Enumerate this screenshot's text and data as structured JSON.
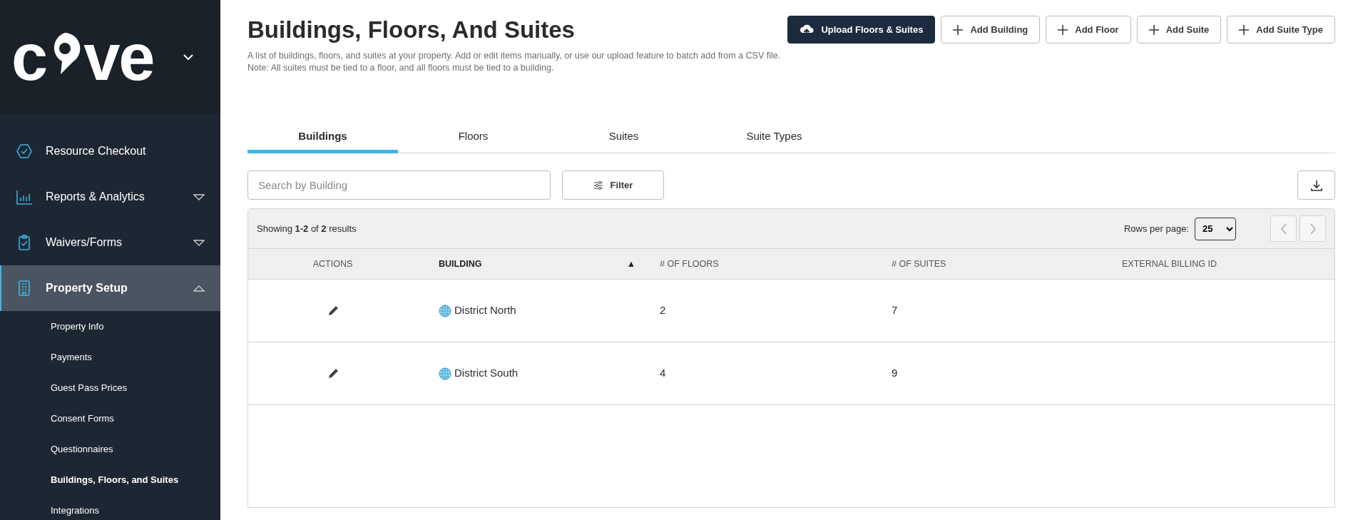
{
  "sidebar": {
    "logo": {
      "start": "c",
      "end": "ve"
    },
    "items": [
      {
        "label": "Resource Checkout",
        "selected": false
      },
      {
        "label": "Reports & Analytics",
        "expanded": false,
        "selected": false
      },
      {
        "label": "Waivers/Forms",
        "expanded": false,
        "selected": false
      },
      {
        "label": "Property Setup",
        "expanded": true,
        "selected": true,
        "children": [
          {
            "label": "Property Info",
            "selected": false
          },
          {
            "label": "Payments",
            "selected": false
          },
          {
            "label": "Guest Pass Prices",
            "selected": false
          },
          {
            "label": "Consent Forms",
            "selected": false
          },
          {
            "label": "Questionnaires",
            "selected": false
          },
          {
            "label": "Buildings, Floors, and Suites",
            "selected": true
          },
          {
            "label": "Integrations",
            "selected": false
          }
        ]
      }
    ]
  },
  "page": {
    "title": "Buildings, Floors, And Suites",
    "description": [
      "A list of buildings, floors, and suites at your property. Add or edit items manually, or use our upload feature to batch add from a CSV file.",
      "Note: All suites must be tied to a floor, and all floors must be tied to a building."
    ],
    "actions": [
      {
        "label": "Upload Floors & Suites",
        "kind": "upload"
      },
      {
        "label": "Add Building",
        "kind": "add"
      },
      {
        "label": "Add Floor",
        "kind": "add"
      },
      {
        "label": "Add Suite",
        "kind": "add"
      },
      {
        "label": "Add Suite Type",
        "kind": "add"
      }
    ]
  },
  "tabs": [
    {
      "label": "Buildings",
      "selected": true
    },
    {
      "label": "Floors",
      "selected": false
    },
    {
      "label": "Suites",
      "selected": false
    },
    {
      "label": "Suite Types",
      "selected": false
    }
  ],
  "search": {
    "placeholder": "Search by Building"
  },
  "filter_button": "Filter",
  "table": {
    "summary": "Showing **1-2** of **2** results",
    "rows_per_page_label": "Rows per page:",
    "rows_per_page": "25",
    "columns": [
      {
        "label": "ACTIONS",
        "sorted": false
      },
      {
        "label": "BUILDING",
        "sorted": true
      },
      {
        "label": "# OF FLOORS",
        "sorted": false
      },
      {
        "label": "# OF SUITES",
        "sorted": false
      },
      {
        "label": "EXTERNAL BILLING ID",
        "sorted": false
      }
    ],
    "sort_indicator": "▲",
    "rows": [
      {
        "building": "District North",
        "floors": "2",
        "suites": "7"
      },
      {
        "building": "District South",
        "floors": "4",
        "suites": "9"
      }
    ]
  }
}
